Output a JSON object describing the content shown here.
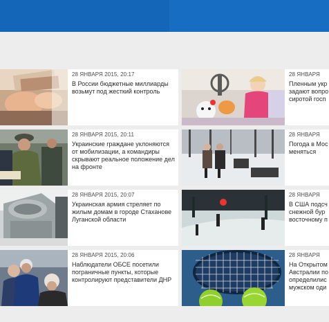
{
  "left_column": [
    {
      "date": "28 ЯНВАРЯ 2015, 20:17",
      "lines": [
        "В России бюджетные миллиарды",
        "возьмут под жесткий контроль"
      ],
      "thumb_icon": "money-counting-image"
    },
    {
      "date": "28 ЯНВАРЯ 2015, 20:11",
      "lines": [
        "Украинские граждане уклоняются",
        "от мобилизации, а командиры",
        "скрывают реальное положение дел",
        "на фронте"
      ],
      "thumb_icon": "soldiers-image"
    },
    {
      "date": "28 ЯНВАРЯ 2015, 20:07",
      "lines": [
        "Украинская армия стреляет по",
        "жилым домам в городе Стаханове",
        "Луганской области"
      ],
      "thumb_icon": "destroyed-building-image"
    },
    {
      "date": "28 ЯНВАРЯ 2015, 20:06",
      "lines": [
        "Наблюдатели ОБСЕ посетили",
        "пограничные пункты, которые",
        "контролируют представители ДНР"
      ],
      "thumb_icon": "observers-image"
    }
  ],
  "right_column": [
    {
      "date": "28 ЯНВАРЯ",
      "lines": [
        "Пленным укр",
        "задают вопро",
        "сиротой госп"
      ],
      "thumb_icon": "child-with-toys-image"
    },
    {
      "date": "28 ЯНВАРЯ",
      "lines": [
        "Погода в Мос",
        "меняться"
      ],
      "thumb_icon": "snowy-park-image"
    },
    {
      "date": "28 ЯНВАРЯ",
      "lines": [
        "В США подсч",
        "снежной бур",
        "восточному п"
      ],
      "thumb_icon": "snowy-night-street-image"
    },
    {
      "date": "28 ЯНВАРЯ",
      "lines": [
        "На Открытом",
        "Австралии по",
        "определилис",
        "мужском оди"
      ],
      "thumb_icon": "tennis-racket-image"
    }
  ]
}
